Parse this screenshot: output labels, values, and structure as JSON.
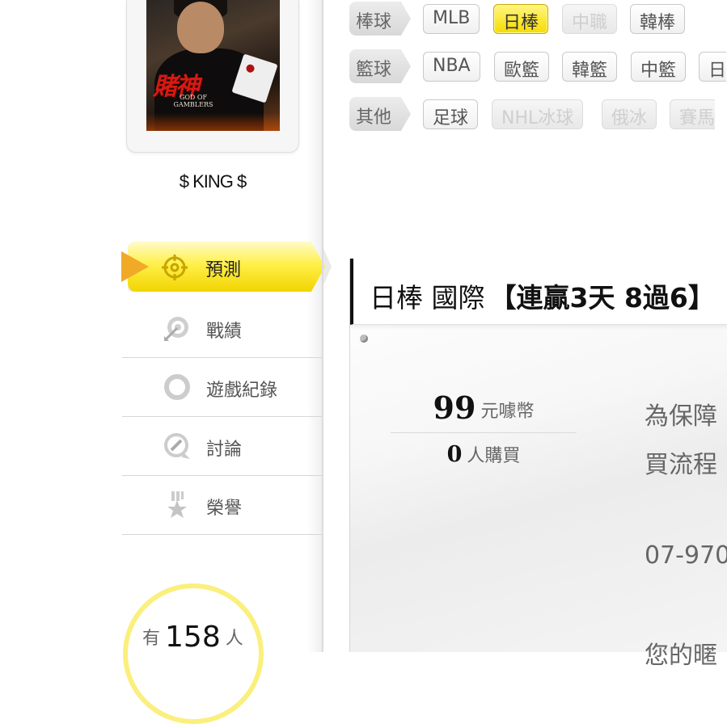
{
  "profile": {
    "poster_title": "賭神",
    "poster_subtitle": "GOD OF GAMBLERS",
    "username": "$ KING $"
  },
  "menu": {
    "items": [
      {
        "label": "預測",
        "icon": "crosshair-icon",
        "active": true
      },
      {
        "label": "戰績",
        "icon": "target-arrow-icon"
      },
      {
        "label": "遊戲紀錄",
        "icon": "ring-icon"
      },
      {
        "label": "討論",
        "icon": "chat-edit-icon"
      },
      {
        "label": "榮譽",
        "icon": "medal-icon"
      }
    ]
  },
  "viewers": {
    "prefix": "有",
    "count": "158",
    "suffix": "人"
  },
  "filters": {
    "rows": [
      {
        "category": "棒球",
        "tags": [
          "MLB",
          "日棒",
          "中職",
          "韓棒"
        ]
      },
      {
        "category": "籃球",
        "tags": [
          "NBA",
          "歐籃",
          "韓籃",
          "中籃",
          "日"
        ]
      },
      {
        "category": "其他",
        "tags": [
          "足球",
          "NHL冰球",
          "俄冰",
          "賽馬"
        ]
      }
    ]
  },
  "main": {
    "league": "日棒 國際",
    "record": "【連贏3天 8過6】",
    "price_value": "99",
    "price_unit": "元噱幣",
    "buyers_value": "0",
    "buyers_unit": "人購買",
    "notice_line1": "為保障",
    "notice_line2": "買流程",
    "phone": "07-970",
    "notice_line3": "您的暱"
  },
  "colors": {
    "active_yellow": "#f6dc00",
    "active_arrow": "#f1a928"
  }
}
